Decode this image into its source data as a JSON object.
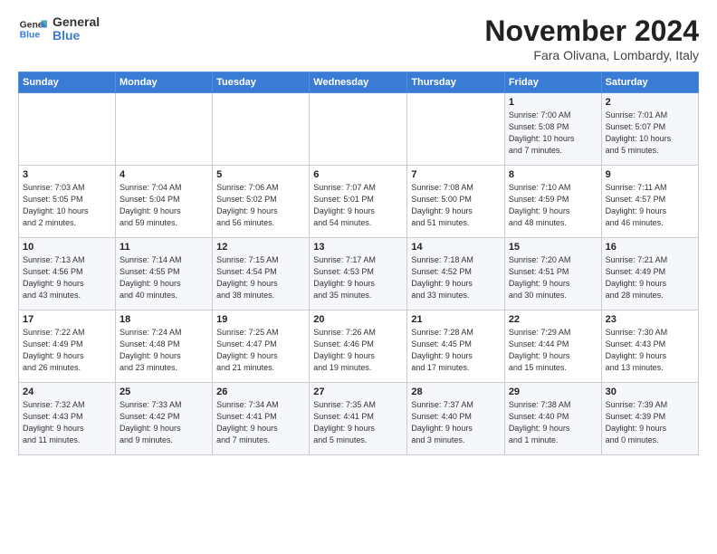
{
  "logo": {
    "line1": "General",
    "line2": "Blue"
  },
  "title": "November 2024",
  "subtitle": "Fara Olivana, Lombardy, Italy",
  "weekdays": [
    "Sunday",
    "Monday",
    "Tuesday",
    "Wednesday",
    "Thursday",
    "Friday",
    "Saturday"
  ],
  "weeks": [
    [
      {
        "day": "",
        "info": ""
      },
      {
        "day": "",
        "info": ""
      },
      {
        "day": "",
        "info": ""
      },
      {
        "day": "",
        "info": ""
      },
      {
        "day": "",
        "info": ""
      },
      {
        "day": "1",
        "info": "Sunrise: 7:00 AM\nSunset: 5:08 PM\nDaylight: 10 hours\nand 7 minutes."
      },
      {
        "day": "2",
        "info": "Sunrise: 7:01 AM\nSunset: 5:07 PM\nDaylight: 10 hours\nand 5 minutes."
      }
    ],
    [
      {
        "day": "3",
        "info": "Sunrise: 7:03 AM\nSunset: 5:05 PM\nDaylight: 10 hours\nand 2 minutes."
      },
      {
        "day": "4",
        "info": "Sunrise: 7:04 AM\nSunset: 5:04 PM\nDaylight: 9 hours\nand 59 minutes."
      },
      {
        "day": "5",
        "info": "Sunrise: 7:06 AM\nSunset: 5:02 PM\nDaylight: 9 hours\nand 56 minutes."
      },
      {
        "day": "6",
        "info": "Sunrise: 7:07 AM\nSunset: 5:01 PM\nDaylight: 9 hours\nand 54 minutes."
      },
      {
        "day": "7",
        "info": "Sunrise: 7:08 AM\nSunset: 5:00 PM\nDaylight: 9 hours\nand 51 minutes."
      },
      {
        "day": "8",
        "info": "Sunrise: 7:10 AM\nSunset: 4:59 PM\nDaylight: 9 hours\nand 48 minutes."
      },
      {
        "day": "9",
        "info": "Sunrise: 7:11 AM\nSunset: 4:57 PM\nDaylight: 9 hours\nand 46 minutes."
      }
    ],
    [
      {
        "day": "10",
        "info": "Sunrise: 7:13 AM\nSunset: 4:56 PM\nDaylight: 9 hours\nand 43 minutes."
      },
      {
        "day": "11",
        "info": "Sunrise: 7:14 AM\nSunset: 4:55 PM\nDaylight: 9 hours\nand 40 minutes."
      },
      {
        "day": "12",
        "info": "Sunrise: 7:15 AM\nSunset: 4:54 PM\nDaylight: 9 hours\nand 38 minutes."
      },
      {
        "day": "13",
        "info": "Sunrise: 7:17 AM\nSunset: 4:53 PM\nDaylight: 9 hours\nand 35 minutes."
      },
      {
        "day": "14",
        "info": "Sunrise: 7:18 AM\nSunset: 4:52 PM\nDaylight: 9 hours\nand 33 minutes."
      },
      {
        "day": "15",
        "info": "Sunrise: 7:20 AM\nSunset: 4:51 PM\nDaylight: 9 hours\nand 30 minutes."
      },
      {
        "day": "16",
        "info": "Sunrise: 7:21 AM\nSunset: 4:49 PM\nDaylight: 9 hours\nand 28 minutes."
      }
    ],
    [
      {
        "day": "17",
        "info": "Sunrise: 7:22 AM\nSunset: 4:49 PM\nDaylight: 9 hours\nand 26 minutes."
      },
      {
        "day": "18",
        "info": "Sunrise: 7:24 AM\nSunset: 4:48 PM\nDaylight: 9 hours\nand 23 minutes."
      },
      {
        "day": "19",
        "info": "Sunrise: 7:25 AM\nSunset: 4:47 PM\nDaylight: 9 hours\nand 21 minutes."
      },
      {
        "day": "20",
        "info": "Sunrise: 7:26 AM\nSunset: 4:46 PM\nDaylight: 9 hours\nand 19 minutes."
      },
      {
        "day": "21",
        "info": "Sunrise: 7:28 AM\nSunset: 4:45 PM\nDaylight: 9 hours\nand 17 minutes."
      },
      {
        "day": "22",
        "info": "Sunrise: 7:29 AM\nSunset: 4:44 PM\nDaylight: 9 hours\nand 15 minutes."
      },
      {
        "day": "23",
        "info": "Sunrise: 7:30 AM\nSunset: 4:43 PM\nDaylight: 9 hours\nand 13 minutes."
      }
    ],
    [
      {
        "day": "24",
        "info": "Sunrise: 7:32 AM\nSunset: 4:43 PM\nDaylight: 9 hours\nand 11 minutes."
      },
      {
        "day": "25",
        "info": "Sunrise: 7:33 AM\nSunset: 4:42 PM\nDaylight: 9 hours\nand 9 minutes."
      },
      {
        "day": "26",
        "info": "Sunrise: 7:34 AM\nSunset: 4:41 PM\nDaylight: 9 hours\nand 7 minutes."
      },
      {
        "day": "27",
        "info": "Sunrise: 7:35 AM\nSunset: 4:41 PM\nDaylight: 9 hours\nand 5 minutes."
      },
      {
        "day": "28",
        "info": "Sunrise: 7:37 AM\nSunset: 4:40 PM\nDaylight: 9 hours\nand 3 minutes."
      },
      {
        "day": "29",
        "info": "Sunrise: 7:38 AM\nSunset: 4:40 PM\nDaylight: 9 hours\nand 1 minute."
      },
      {
        "day": "30",
        "info": "Sunrise: 7:39 AM\nSunset: 4:39 PM\nDaylight: 9 hours\nand 0 minutes."
      }
    ]
  ]
}
